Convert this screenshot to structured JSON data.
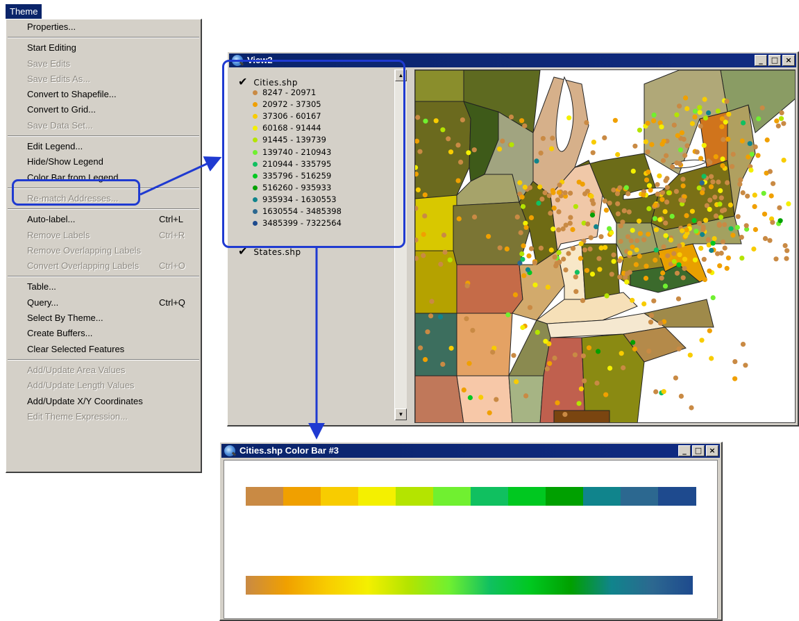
{
  "menu": {
    "title": "Theme",
    "items": [
      {
        "label": "Properties...",
        "disabled": false
      },
      {
        "label": "Start Editing",
        "disabled": false
      },
      {
        "label": "Save Edits",
        "disabled": true
      },
      {
        "label": "Save Edits As...",
        "disabled": true
      },
      {
        "label": "Convert to Shapefile...",
        "disabled": false
      },
      {
        "label": "Convert to Grid...",
        "disabled": false
      },
      {
        "label": "Save Data Set...",
        "disabled": true
      },
      {
        "label": "Edit Legend...",
        "disabled": false
      },
      {
        "label": "Hide/Show Legend",
        "disabled": false
      },
      {
        "label": "Color Bar from Legend",
        "disabled": false
      },
      {
        "label": "Re-match Addresses...",
        "disabled": true
      },
      {
        "label": "Auto-label...",
        "shortcut": "Ctrl+L",
        "disabled": false
      },
      {
        "label": "Remove Labels",
        "shortcut": "Ctrl+R",
        "disabled": true
      },
      {
        "label": "Remove Overlapping Labels",
        "disabled": true
      },
      {
        "label": "Convert Overlapping Labels",
        "shortcut": "Ctrl+O",
        "disabled": true
      },
      {
        "label": "Table...",
        "disabled": false
      },
      {
        "label": "Query...",
        "shortcut": "Ctrl+Q",
        "disabled": false
      },
      {
        "label": "Select By Theme...",
        "disabled": false
      },
      {
        "label": "Create Buffers...",
        "disabled": false
      },
      {
        "label": "Clear Selected Features",
        "disabled": false
      },
      {
        "label": "Add/Update Area Values",
        "disabled": true
      },
      {
        "label": "Add/Update Length Values",
        "disabled": true
      },
      {
        "label": "Add/Update X/Y Coordinates",
        "disabled": false
      },
      {
        "label": "Edit Theme Expression...",
        "disabled": true
      }
    ]
  },
  "view_window": {
    "title": "View2",
    "themes": [
      {
        "name": "Cities.shp",
        "checked": true
      },
      {
        "name": "States.shp",
        "checked": true
      }
    ],
    "legend": [
      {
        "label": "8247 - 20971",
        "color": "#c98a44"
      },
      {
        "label": "20972 - 37305",
        "color": "#f0a000"
      },
      {
        "label": "37306 - 60167",
        "color": "#f8cc00"
      },
      {
        "label": "60168 - 91444",
        "color": "#f4f000"
      },
      {
        "label": "91445 - 139739",
        "color": "#b4e400"
      },
      {
        "label": "139740 - 210943",
        "color": "#70f030"
      },
      {
        "label": "210944 - 335795",
        "color": "#10c060"
      },
      {
        "label": "335796 - 516259",
        "color": "#00c820"
      },
      {
        "label": "516260 - 935933",
        "color": "#00a000"
      },
      {
        "label": "935934 - 1630553",
        "color": "#10848c"
      },
      {
        "label": "1630554 - 3485398",
        "color": "#2c6890"
      },
      {
        "label": "3485399 - 7322564",
        "color": "#1e4a8e"
      }
    ]
  },
  "colorbar_window": {
    "title": "Cities.shp Color Bar #3"
  },
  "window_buttons": {
    "minimize": "_",
    "maximize": "□",
    "close": "×"
  }
}
